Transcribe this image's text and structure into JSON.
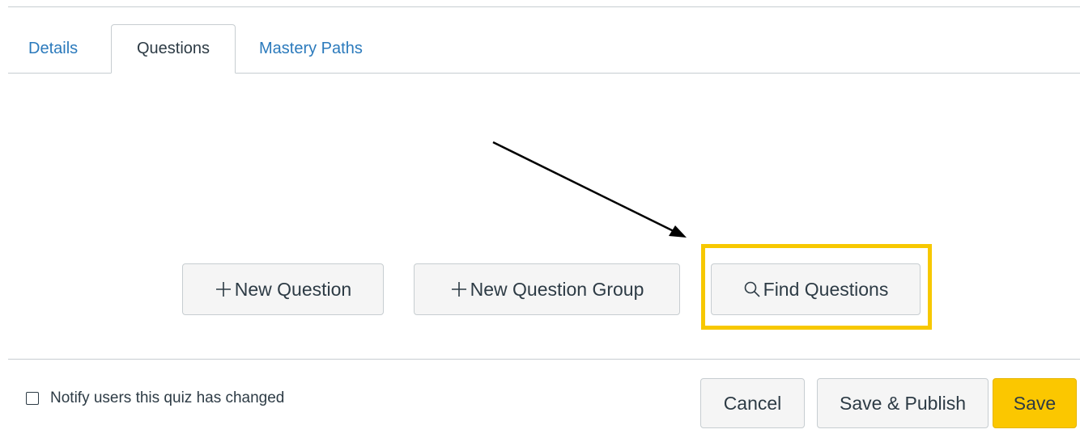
{
  "tabs": {
    "details": "Details",
    "questions": "Questions",
    "mastery_paths": "Mastery Paths"
  },
  "actions": {
    "new_question": "New Question",
    "new_question_group": "New Question Group",
    "find_questions": "Find Questions"
  },
  "icons": {
    "add": "plus-icon",
    "search": "search-icon"
  },
  "footer": {
    "notify_label": "Notify users this quiz has changed",
    "notify_checked": false,
    "cancel": "Cancel",
    "save_publish": "Save & Publish",
    "save": "Save"
  },
  "colors": {
    "highlight": "#f7c800",
    "link": "#2b7abc",
    "save_button": "#fbc700"
  }
}
